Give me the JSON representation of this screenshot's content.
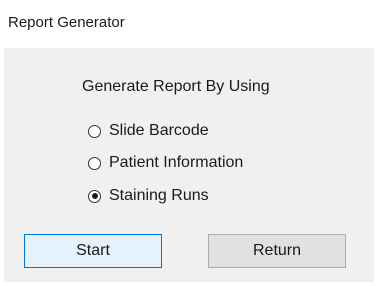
{
  "window": {
    "title": "Report Generator"
  },
  "form": {
    "heading": "Generate Report By Using",
    "options": [
      {
        "label": "Slide Barcode",
        "selected": false
      },
      {
        "label": "Patient Information",
        "selected": false
      },
      {
        "label": "Staining Runs",
        "selected": true
      }
    ]
  },
  "buttons": {
    "start_label": "Start",
    "return_label": "Return"
  },
  "colors": {
    "accent_border": "#0078d7",
    "start_fill": "#e5f1fb",
    "client_background": "#f0f0f0"
  }
}
